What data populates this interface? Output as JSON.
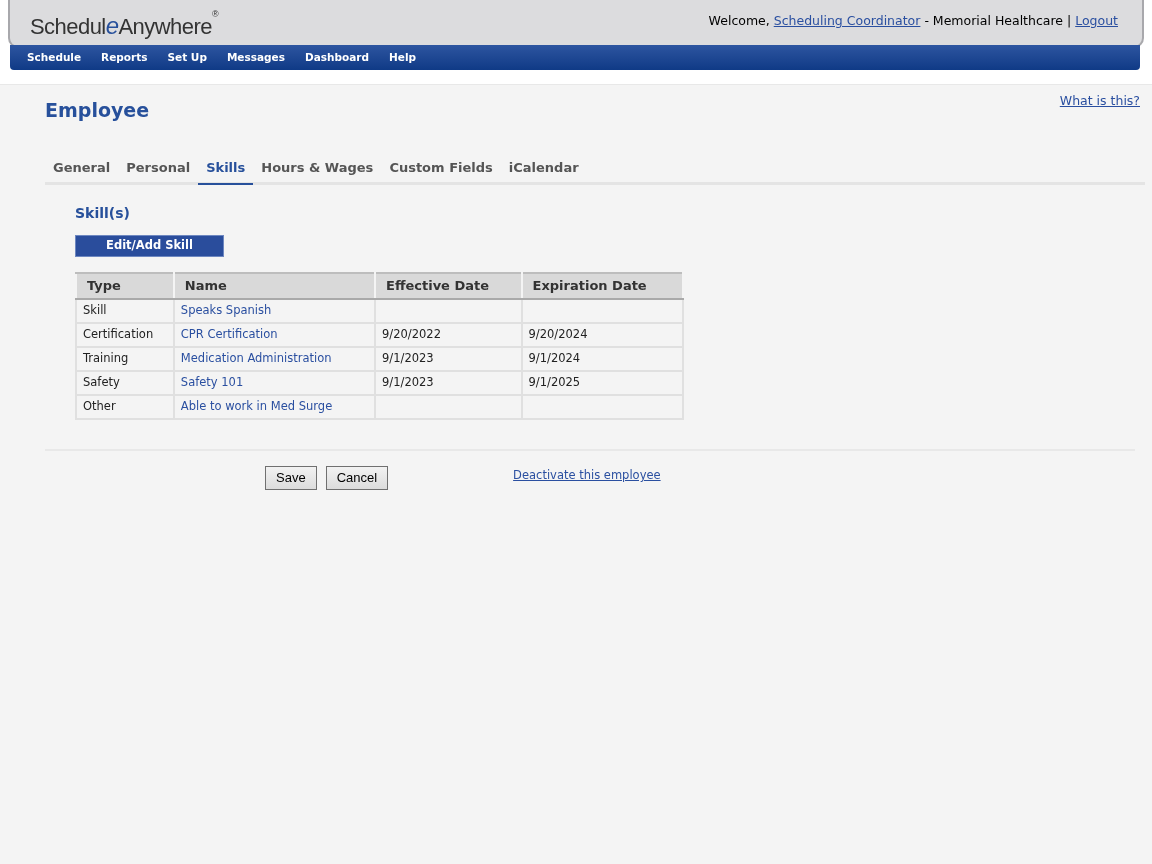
{
  "header": {
    "logo": [
      "Schedul",
      "e",
      "Anywhere",
      "®"
    ],
    "welcome_prefix": "Welcome, ",
    "user_link": "Scheduling Coordinator",
    "organization": " - Memorial Healthcare | ",
    "logout_link": "Logout"
  },
  "nav": [
    "Schedule",
    "Reports",
    "Set Up",
    "Messages",
    "Dashboard",
    "Help"
  ],
  "page": {
    "title": "Employee",
    "help_link": "What is this?"
  },
  "tabs": [
    {
      "label": "General",
      "selected": false
    },
    {
      "label": "Personal",
      "selected": false
    },
    {
      "label": "Skills",
      "selected": true
    },
    {
      "label": "Hours & Wages",
      "selected": false
    },
    {
      "label": "Custom Fields",
      "selected": false
    },
    {
      "label": "iCalendar",
      "selected": false
    }
  ],
  "section": {
    "title": "Skill(s)",
    "button": "Edit/Add Skill"
  },
  "table": {
    "columns": [
      "Type",
      "Name",
      "Effective Date",
      "Expiration Date"
    ],
    "rows": [
      [
        "Skill",
        "Speaks Spanish",
        "",
        ""
      ],
      [
        "Certification",
        "CPR Certification",
        "9/20/2022",
        "9/20/2024"
      ],
      [
        "Training",
        "Medication Administration",
        "9/1/2023",
        "9/1/2024"
      ],
      [
        "Safety",
        "Safety 101",
        "9/1/2023",
        "9/1/2025"
      ],
      [
        "Other",
        "Able to work in Med Surge",
        "",
        ""
      ]
    ]
  },
  "footer": {
    "buttons": [
      "Save",
      "Cancel"
    ],
    "deactivate_link": "Deactivate this employee"
  }
}
